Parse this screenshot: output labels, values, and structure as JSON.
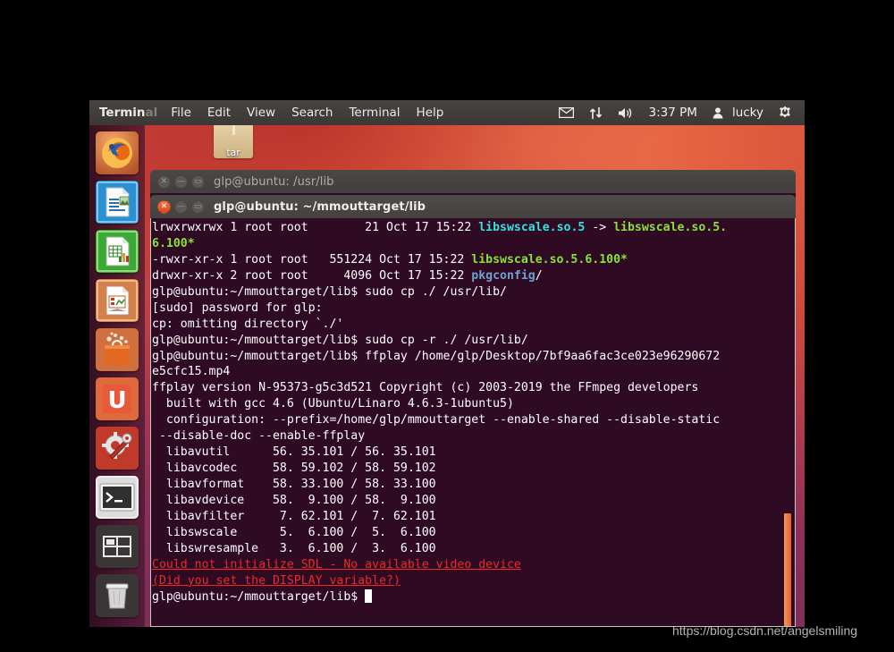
{
  "panel": {
    "app_name_visible": "Termin",
    "app_name_faded": "al",
    "menus": [
      "File",
      "Edit",
      "View",
      "Search",
      "Terminal",
      "Help"
    ],
    "tray_icons": [
      "mail-icon",
      "network-up-down-icon",
      "volume-icon"
    ],
    "clock": "3:37 PM",
    "user": "lucky",
    "session_icon": "gear-power-icon"
  },
  "launcher": {
    "items": [
      {
        "name": "firefox",
        "label": "Firefox"
      },
      {
        "name": "libreoffice-writer",
        "label": "LibreOffice Writer"
      },
      {
        "name": "libreoffice-calc",
        "label": "LibreOffice Calc"
      },
      {
        "name": "libreoffice-impress",
        "label": "LibreOffice Impress"
      },
      {
        "name": "ubuntu-software-center",
        "label": "Ubuntu Software Center"
      },
      {
        "name": "ubuntu-one",
        "label": "Ubuntu One"
      },
      {
        "name": "system-settings",
        "label": "System Settings"
      },
      {
        "name": "terminal",
        "label": "Terminal"
      },
      {
        "name": "workspace-switcher",
        "label": "Workspace Switcher"
      },
      {
        "name": "trash",
        "label": "Trash"
      }
    ]
  },
  "desktop": {
    "file_icon_label": "tar"
  },
  "windows": {
    "background": {
      "title": "glp@ubuntu: /usr/lib"
    },
    "foreground": {
      "title": "glp@ubuntu: ~/mmouttarget/lib"
    }
  },
  "terminal": {
    "prompt": "glp@ubuntu:~/mmouttarget/lib$",
    "lines": [
      {
        "segments": [
          {
            "t": "lrwxrwxrwx 1 root root        21 Oct 17 15:22 ",
            "c": ""
          },
          {
            "t": "libswscale.so.5",
            "c": "c-link"
          },
          {
            "t": " -> ",
            "c": ""
          },
          {
            "t": "libswscale.so.5.",
            "c": "c-exec"
          }
        ]
      },
      {
        "segments": [
          {
            "t": "6.100*",
            "c": "c-exec"
          }
        ]
      },
      {
        "segments": [
          {
            "t": "-rwxr-xr-x 1 root root   551224 Oct 17 15:22 ",
            "c": ""
          },
          {
            "t": "libswscale.so.5.6.100*",
            "c": "c-exec"
          }
        ]
      },
      {
        "segments": [
          {
            "t": "drwxr-xr-x 2 root root     4096 Oct 17 15:22 ",
            "c": ""
          },
          {
            "t": "pkgconfig",
            "c": "c-dir"
          },
          {
            "t": "/",
            "c": ""
          }
        ]
      },
      {
        "segments": [
          {
            "t": "glp@ubuntu:~/mmouttarget/lib$ sudo cp ./ /usr/lib/",
            "c": ""
          }
        ]
      },
      {
        "segments": [
          {
            "t": "[sudo] password for glp:",
            "c": ""
          }
        ]
      },
      {
        "segments": [
          {
            "t": "cp: omitting directory `./'",
            "c": ""
          }
        ]
      },
      {
        "segments": [
          {
            "t": "glp@ubuntu:~/mmouttarget/lib$ sudo cp -r ./ /usr/lib/",
            "c": ""
          }
        ]
      },
      {
        "segments": [
          {
            "t": "glp@ubuntu:~/mmouttarget/lib$ ffplay /home/glp/Desktop/7bf9aa6fac3ce023e96290672",
            "c": ""
          }
        ]
      },
      {
        "segments": [
          {
            "t": "e5cfc15.mp4",
            "c": ""
          }
        ]
      },
      {
        "segments": [
          {
            "t": "ffplay version N-95373-g5c3d521 Copyright (c) 2003-2019 the FFmpeg developers",
            "c": ""
          }
        ]
      },
      {
        "segments": [
          {
            "t": "  built with gcc 4.6 (Ubuntu/Linaro 4.6.3-1ubuntu5)",
            "c": ""
          }
        ]
      },
      {
        "segments": [
          {
            "t": "  configuration: --prefix=/home/glp/mmouttarget --enable-shared --disable-static",
            "c": ""
          }
        ]
      },
      {
        "segments": [
          {
            "t": " --disable-doc --enable-ffplay",
            "c": ""
          }
        ]
      },
      {
        "segments": [
          {
            "t": "  libavutil      56. 35.101 / 56. 35.101",
            "c": ""
          }
        ]
      },
      {
        "segments": [
          {
            "t": "  libavcodec     58. 59.102 / 58. 59.102",
            "c": ""
          }
        ]
      },
      {
        "segments": [
          {
            "t": "  libavformat    58. 33.100 / 58. 33.100",
            "c": ""
          }
        ]
      },
      {
        "segments": [
          {
            "t": "  libavdevice    58.  9.100 / 58.  9.100",
            "c": ""
          }
        ]
      },
      {
        "segments": [
          {
            "t": "  libavfilter     7. 62.101 /  7. 62.101",
            "c": ""
          }
        ]
      },
      {
        "segments": [
          {
            "t": "  libswscale      5.  6.100 /  5.  6.100",
            "c": ""
          }
        ]
      },
      {
        "segments": [
          {
            "t": "  libswresample   3.  6.100 /  3.  6.100",
            "c": ""
          }
        ]
      },
      {
        "segments": [
          {
            "t": "Could not initialize SDL - No available video device",
            "c": "c-err"
          }
        ]
      },
      {
        "segments": [
          {
            "t": "(Did you set the DISPLAY variable?)",
            "c": "c-err"
          }
        ]
      },
      {
        "segments": [
          {
            "t": "glp@ubuntu:~/mmouttarget/lib$ ",
            "c": ""
          },
          {
            "cursor": true
          }
        ]
      }
    ],
    "colors": {
      "background": "#2f0a23",
      "foreground": "#ffffff",
      "symlink": "#34e2e2",
      "executable": "#8ae234",
      "directory": "#729fcf",
      "error": "#ef2929",
      "scrollbar": "#e8622a"
    }
  },
  "watermark": "https://blog.csdn.net/angelsmiling"
}
